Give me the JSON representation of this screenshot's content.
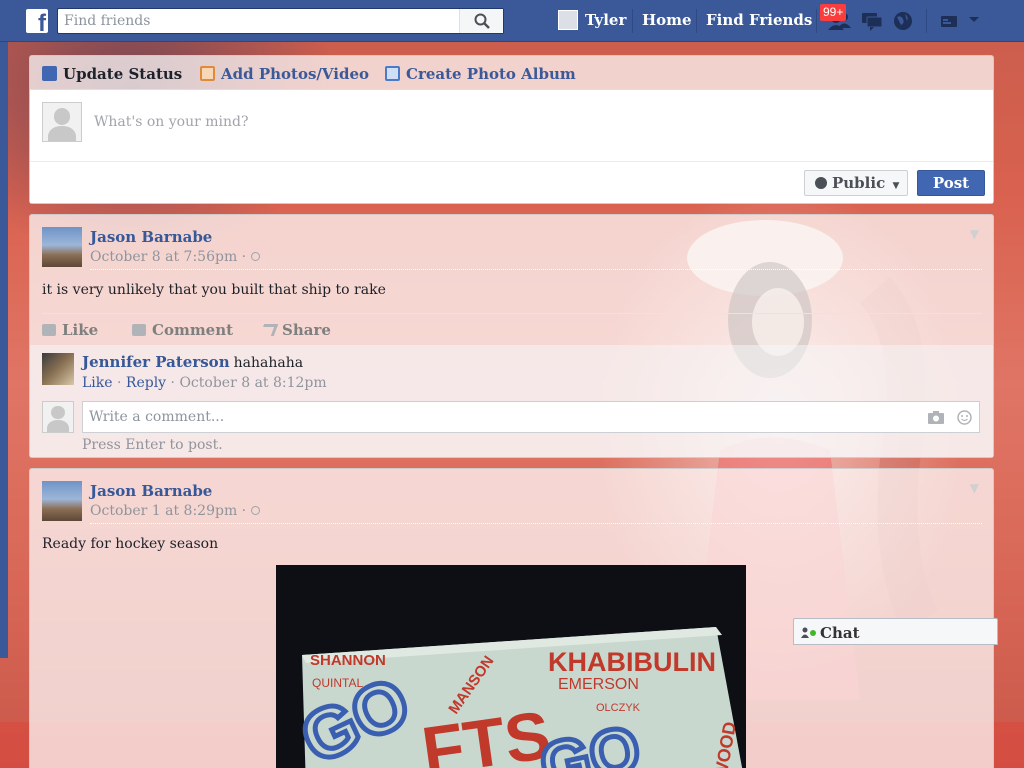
{
  "topbar": {
    "logo": "f",
    "search_placeholder": "Find friends",
    "user_name": "Tyler",
    "nav_home": "Home",
    "nav_find_friends": "Find Friends",
    "friend_requests_badge": "99+",
    "icons": [
      "friend-requests-icon",
      "messages-icon",
      "notifications-globe-icon",
      "privacy-shortcuts-icon",
      "account-menu-icon"
    ]
  },
  "composer": {
    "tabs": [
      {
        "label": "Update Status",
        "icon": "pencil-icon"
      },
      {
        "label": "Add Photos/Video",
        "icon": "photo-icon"
      },
      {
        "label": "Create Photo Album",
        "icon": "album-icon"
      }
    ],
    "placeholder": "What's on your mind?",
    "privacy_label": "Public",
    "post_label": "Post"
  },
  "posts": [
    {
      "author": "Jason Barnabe",
      "timestamp": "October 8 at 7:56pm",
      "separator": "·",
      "text": "it is very unlikely that you built that ship to rake",
      "actions": {
        "like": "Like",
        "comment": "Comment",
        "share": "Share"
      },
      "comment": {
        "author": "Jennifer Paterson",
        "text": "hahahaha",
        "like": "Like",
        "reply": "Reply",
        "timestamp": "October 8 at 8:12pm"
      },
      "write_placeholder": "Write a comment...",
      "press_enter": "Press Enter to post."
    },
    {
      "author": "Jason Barnabe",
      "timestamp": "October 1 at 8:29pm",
      "separator": "·",
      "text": "Ready for hockey season",
      "photo_text": [
        "SHANNON",
        "QUINTAL",
        "MANSON",
        "KHABIBULIN",
        "EMERSON",
        "OLCZYK",
        "GO",
        "FTS",
        "GO",
        "WOOD"
      ]
    }
  ],
  "chat": {
    "label": "Chat"
  },
  "colors": {
    "brand": "#3b5998",
    "link": "#365899",
    "badge": "#fa3e3e",
    "post_button": "#4267b2",
    "online": "#42b72a"
  }
}
